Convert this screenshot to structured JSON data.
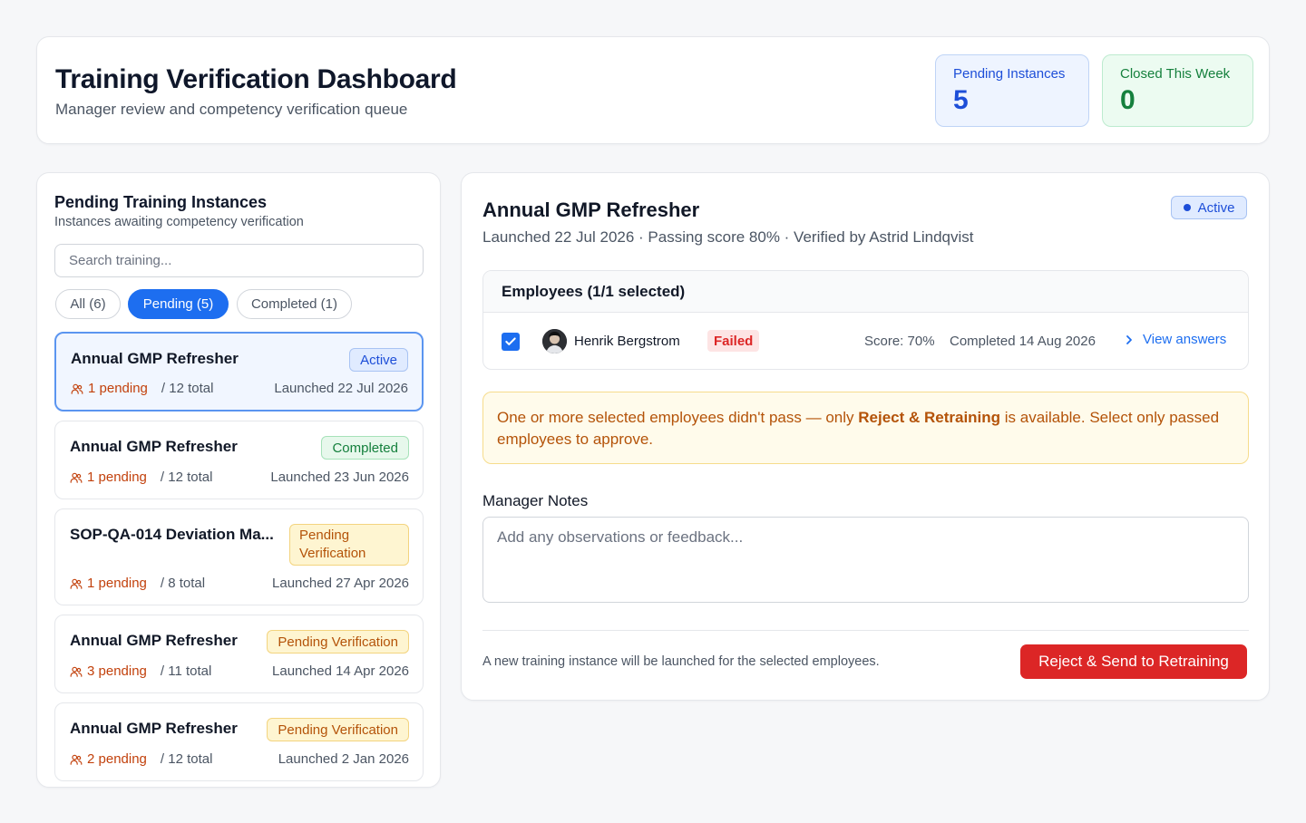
{
  "header": {
    "title": "Training Verification Dashboard",
    "subtitle": "Manager review and competency verification queue",
    "stats": {
      "pending_label": "Pending Instances",
      "pending_value": "5",
      "closed_label": "Closed This Week",
      "closed_value": "0"
    }
  },
  "sidebar": {
    "title": "Pending Training Instances",
    "subtitle": "Instances awaiting competency verification",
    "search_placeholder": "Search training...",
    "filters": {
      "all": "All (6)",
      "pending": "Pending (5)",
      "completed": "Completed (1)",
      "selected": "pending"
    },
    "instances": [
      {
        "name": "Annual GMP Refresher",
        "status": "Active",
        "pending": "1 pending",
        "total": "/ 12 total",
        "launched": "Launched 22 Jul 2026"
      },
      {
        "name": "Annual GMP Refresher",
        "status": "Completed",
        "pending": "1 pending",
        "total": "/ 12 total",
        "launched": "Launched 23 Jun 2026"
      },
      {
        "name": "SOP-QA-014 Deviation Ma...",
        "status": "Pending Verification",
        "pending": "1 pending",
        "total": "/ 8 total",
        "launched": "Launched 27 Apr 2026"
      },
      {
        "name": "Annual GMP Refresher",
        "status": "Pending Verification",
        "pending": "3 pending",
        "total": "/ 11 total",
        "launched": "Launched 14 Apr 2026"
      },
      {
        "name": "Annual GMP Refresher",
        "status": "Pending Verification",
        "pending": "2 pending",
        "total": "/ 12 total",
        "launched": "Launched 2 Jan 2026"
      }
    ]
  },
  "detail": {
    "title": "Annual GMP Refresher",
    "subtitle": "Launched 22 Jul 2026 · Passing score 80% · Verified by Astrid Lindqvist",
    "status": "Active",
    "employees_header": "Employees (1/1 selected)",
    "employee": {
      "name": "Henrik Bergstrom",
      "result": "Failed",
      "score": "Score: 70%",
      "completed": "Completed 14 Aug 2026",
      "view_answers": "View answers",
      "checked": true
    },
    "warning": {
      "before": "One or more selected employees didn't pass — only ",
      "bold": "Reject & Retraining",
      "after": " is available. Select only passed employees to approve."
    },
    "notes_label": "Manager Notes",
    "notes_placeholder": "Add any observations or feedback...",
    "footer_note": "A new training instance will be launched for the selected employees.",
    "reject_button": "Reject & Send to Retraining"
  },
  "icons": {
    "users": "users-icon",
    "check": "check-icon",
    "chevron": "chevron-right-icon",
    "dot": "dot-icon"
  },
  "colors": {
    "accent": "#1d6ef0",
    "danger": "#dc2626",
    "warning": "#b45309",
    "success": "#15803d"
  }
}
